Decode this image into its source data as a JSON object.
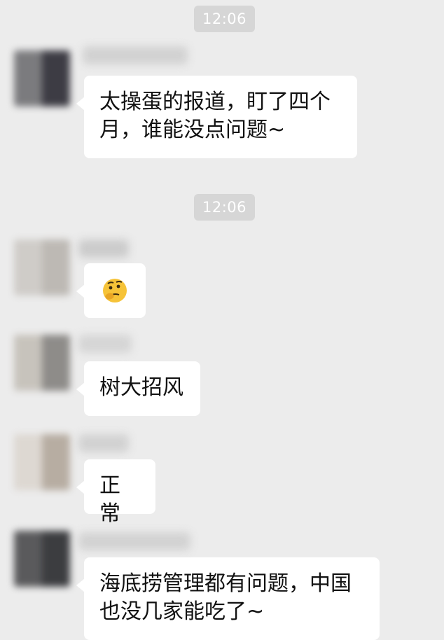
{
  "timestamps": [
    "12:06",
    "12:06"
  ],
  "messages": [
    {
      "text_line1": "太操蛋的报道，盯了四个",
      "text_line2": "月，谁能没点问题~"
    },
    {
      "emoji": "thinking-face-icon"
    },
    {
      "text": "树大招风"
    },
    {
      "text": "正常"
    },
    {
      "text_line1": "海底捞管理都有问题，中国",
      "text_line2": "也没几家能吃了~"
    }
  ],
  "colors": {
    "chat_background": "#ececec",
    "bubble_background": "#ffffff",
    "timestamp_background": "#d6d6d6",
    "timestamp_text": "#ffffff",
    "emoji_yellow": "#f6c338"
  }
}
